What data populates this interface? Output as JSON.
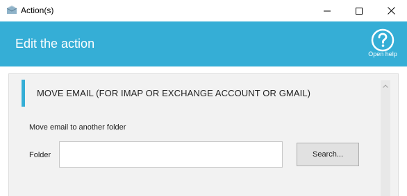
{
  "theme": {
    "accent": "#35aed6"
  },
  "window": {
    "title": "Action(s)",
    "icon": "envelope-app-icon",
    "controls": [
      "minimize-icon",
      "maximize-icon",
      "close-icon"
    ]
  },
  "header": {
    "title": "Edit the action",
    "help_label": "Open help",
    "help_icon": "question-circle-icon"
  },
  "section": {
    "title": "MOVE EMAIL (FOR IMAP OR EXCHANGE ACCOUNT OR GMAIL)",
    "description": "Move email to another folder"
  },
  "form": {
    "folder_label": "Folder",
    "folder_value": "",
    "search_label": "Search..."
  }
}
